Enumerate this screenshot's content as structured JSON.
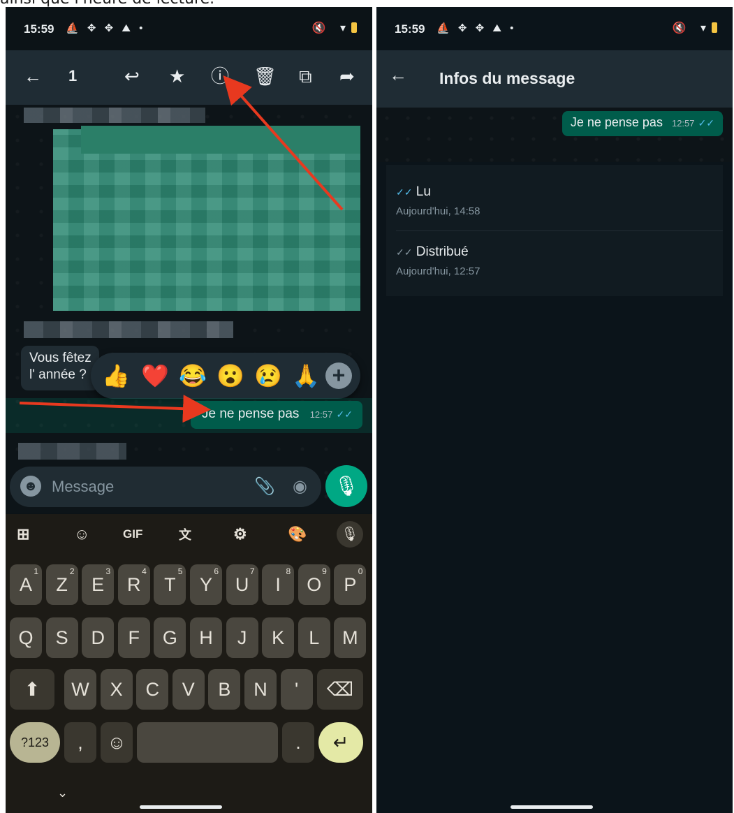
{
  "caption": "ainsi que l'heure de lecture.",
  "left": {
    "status": {
      "time": "15:59",
      "icons": "⛵ ✥ ✥ ⛰ •",
      "right": "🔇 ▾"
    },
    "actionbar": {
      "back": "←",
      "count": "1",
      "reply": "↩",
      "star": "★",
      "info": "ⓘ",
      "delete": "🗑",
      "copy": "⧉",
      "forward": "➦"
    },
    "incoming_text": "Vous fêtez l' année ?",
    "reactions": [
      "👍",
      "❤️",
      "😂",
      "😮",
      "😢",
      "🙏"
    ],
    "reaction_more": "+",
    "outgoing": {
      "text": "Je ne pense pas",
      "time": "12:57",
      "ticks": "✓✓"
    },
    "input": {
      "placeholder": "Message",
      "emoji_icon": "☻",
      "attach_icon": "📎",
      "camera_icon": "◉",
      "mic_icon": "🎙"
    },
    "keyboard": {
      "toolbar": [
        "⊞",
        "☺",
        "GIF",
        "文",
        "⚙",
        "🎨"
      ],
      "row1": [
        {
          "k": "A",
          "s": "1"
        },
        {
          "k": "Z",
          "s": "2"
        },
        {
          "k": "E",
          "s": "3"
        },
        {
          "k": "R",
          "s": "4"
        },
        {
          "k": "T",
          "s": "5"
        },
        {
          "k": "Y",
          "s": "6"
        },
        {
          "k": "U",
          "s": "7"
        },
        {
          "k": "I",
          "s": "8"
        },
        {
          "k": "O",
          "s": "9"
        },
        {
          "k": "P",
          "s": "0"
        }
      ],
      "row2": [
        "Q",
        "S",
        "D",
        "F",
        "G",
        "H",
        "J",
        "K",
        "L",
        "M"
      ],
      "row3": [
        "W",
        "X",
        "C",
        "V",
        "B",
        "N",
        "'"
      ],
      "shift": "⬆",
      "backspace": "⌫",
      "sym": "?123",
      "comma": ",",
      "emoji": "☺",
      "period": ".",
      "enter": "↵",
      "collapse": "⌄"
    }
  },
  "right": {
    "status": {
      "time": "15:59",
      "icons": "⛵ ✥ ✥ ⛰ •",
      "right": "🔇 ▾"
    },
    "back": "←",
    "title": "Infos du message",
    "bubble": {
      "text": "Je ne pense pas",
      "time": "12:57",
      "ticks": "✓✓"
    },
    "read": {
      "ticks": "✓✓",
      "label": "Lu",
      "date": "Aujourd'hui, 14:58"
    },
    "delivered": {
      "ticks": "✓✓",
      "label": "Distribué",
      "date": "Aujourd'hui, 12:57"
    }
  },
  "colors": {
    "accent": "#00a884",
    "bubble": "#005c4b",
    "header": "#1f2c34",
    "read_ticks": "#53bdeb",
    "arrow": "#e8391f"
  }
}
